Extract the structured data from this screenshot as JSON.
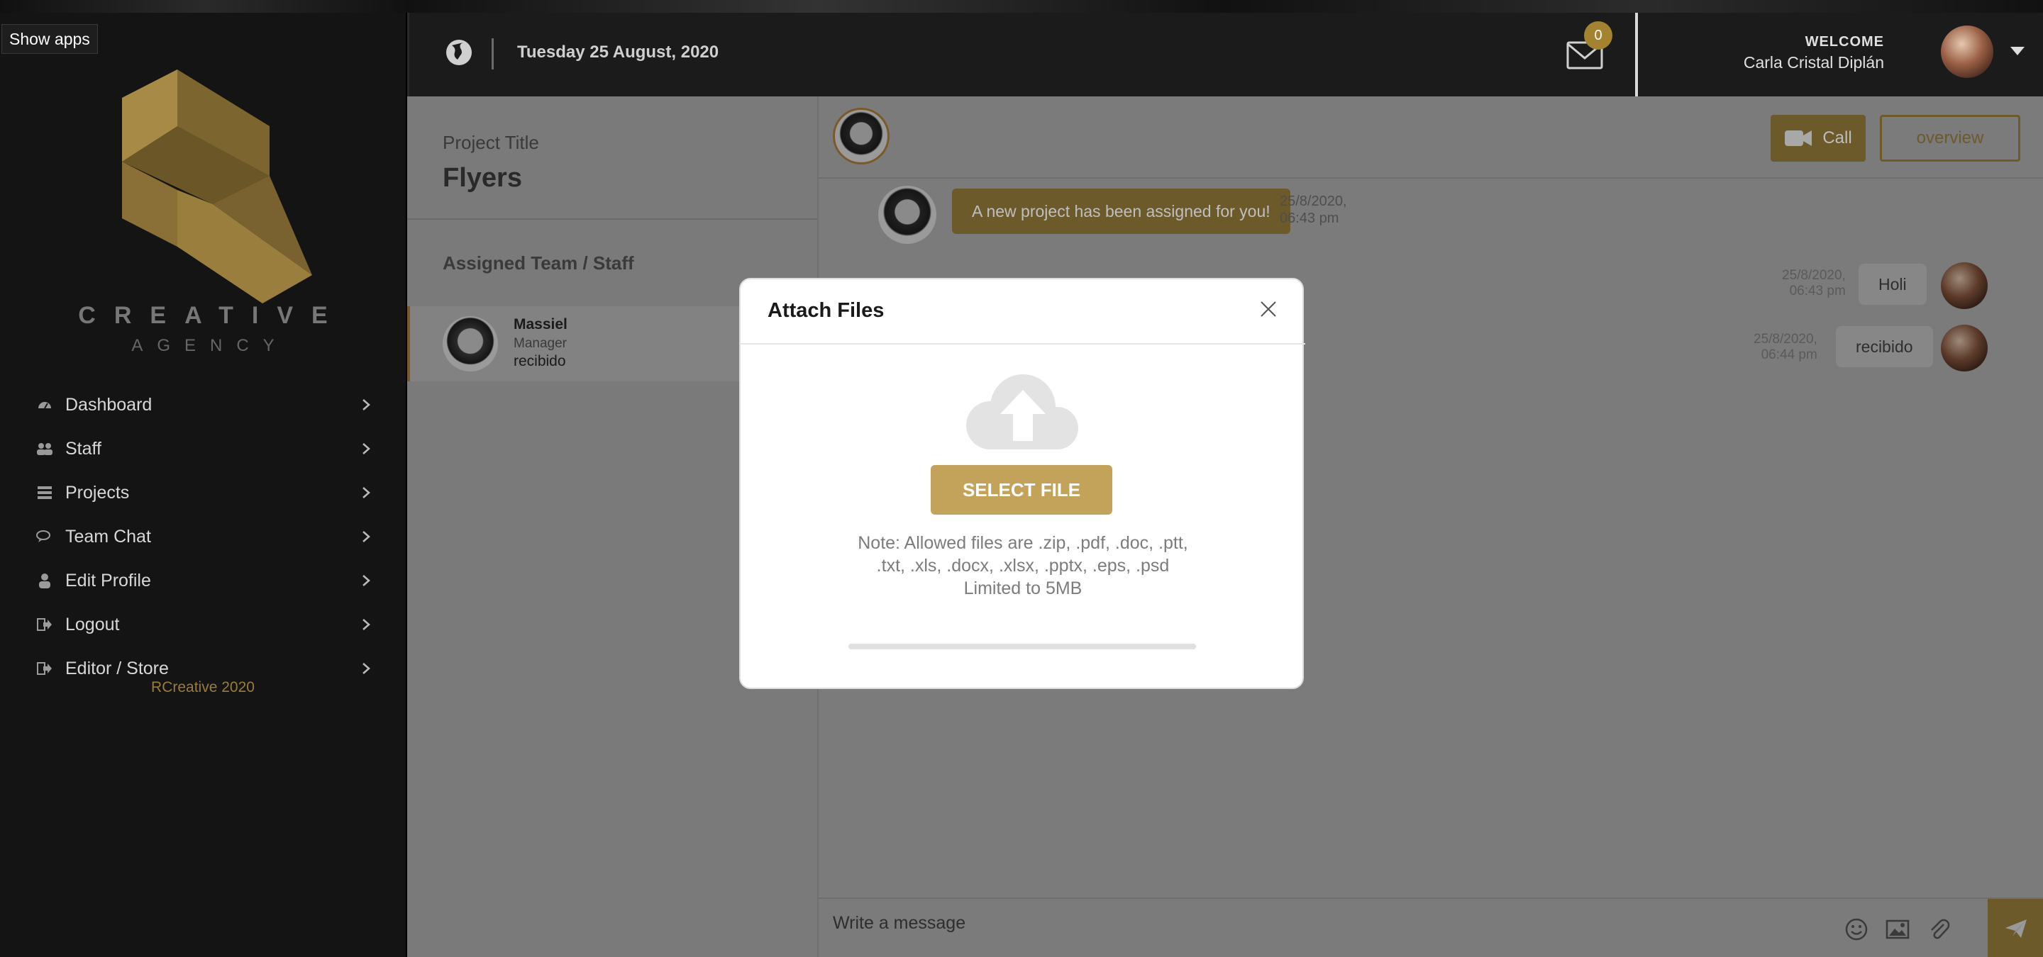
{
  "top": {
    "show_apps": "Show apps"
  },
  "brand": {
    "line1": "CREATIVE",
    "line2": "AGENCY",
    "footer": "RCreative 2020"
  },
  "nav": [
    {
      "label": "Dashboard",
      "icon": "dashboard-icon"
    },
    {
      "label": "Staff",
      "icon": "users-icon"
    },
    {
      "label": "Projects",
      "icon": "projects-icon"
    },
    {
      "label": "Team Chat",
      "icon": "chat-icon"
    },
    {
      "label": "Edit Profile",
      "icon": "user-icon"
    },
    {
      "label": "Logout",
      "icon": "logout-icon"
    },
    {
      "label": "Editor / Store",
      "icon": "logout-icon"
    }
  ],
  "header": {
    "date": "Tuesday 25 August, 2020",
    "mail_count": "0",
    "welcome": "WELCOME",
    "user_name": "Carla Cristal Diplán"
  },
  "project": {
    "label": "Project Title",
    "title": "Flyers",
    "team_label": "Assigned Team / Staff",
    "member": {
      "name": "Massiel",
      "role": "Manager",
      "status": "recibido"
    }
  },
  "chat": {
    "call_label": "Call",
    "overview_label": "overview",
    "messages": [
      {
        "text": "A new project has been assigned for you!",
        "date": "25/8/2020,",
        "time": "06:43 pm"
      },
      {
        "text": "Holi",
        "date": "25/8/2020,",
        "time": "06:43 pm"
      },
      {
        "text": "recibido",
        "date": "25/8/2020,",
        "time": "06:44 pm"
      }
    ],
    "composer_placeholder": "Write a message"
  },
  "modal": {
    "title": "Attach Files",
    "select_label": "SELECT FILE",
    "note_line1": "Note: Allowed files are .zip, .pdf, .doc, .ptt,",
    "note_line2": ".txt, .xls, .docx, .xlsx, .pptx, .eps, .psd",
    "note_line3": "Limited to 5MB",
    "progress": 0
  },
  "colors": {
    "gold": "#c3a35a",
    "dark": "#141414",
    "overlay": "#7b7b7b"
  }
}
